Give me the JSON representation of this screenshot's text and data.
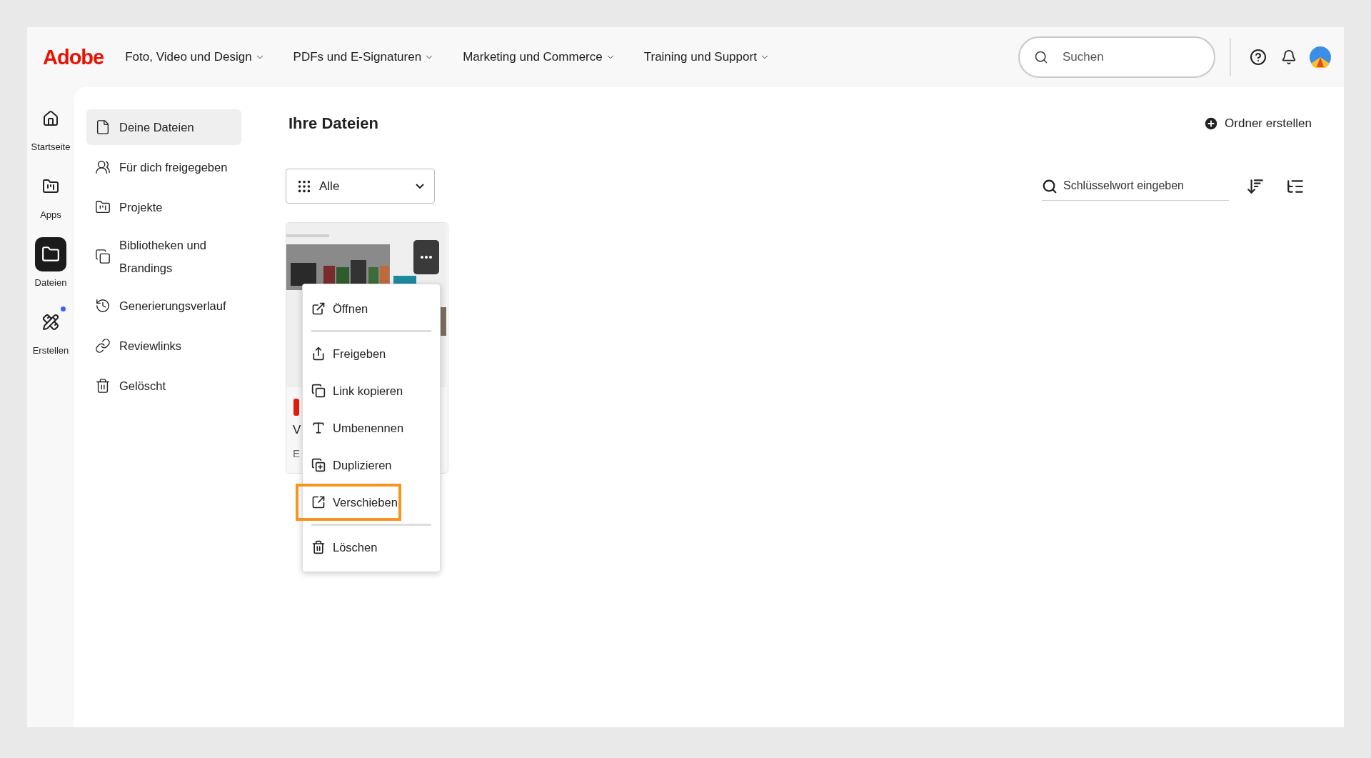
{
  "header": {
    "logo": "Adobe",
    "nav": [
      {
        "label": "Foto, Video und Design"
      },
      {
        "label": "PDFs und E-Signaturen"
      },
      {
        "label": "Marketing und Commerce"
      },
      {
        "label": "Training und Support"
      }
    ],
    "search": {
      "placeholder": "Suchen"
    }
  },
  "rail": [
    {
      "label": "Startseite",
      "selected": false,
      "notification": false
    },
    {
      "label": "Apps",
      "selected": false,
      "notification": false
    },
    {
      "label": "Dateien",
      "selected": true,
      "notification": false
    },
    {
      "label": "Erstellen",
      "selected": false,
      "notification": true
    }
  ],
  "sidebar": [
    {
      "label": "Deine Dateien",
      "selected": true
    },
    {
      "label": "Für dich freigegeben",
      "selected": false
    },
    {
      "label": "Projekte",
      "selected": false
    },
    {
      "label": "Bibliotheken und Brandings",
      "selected": false
    },
    {
      "label": "Generierungsverlauf",
      "selected": false
    },
    {
      "label": "Reviewlinks",
      "selected": false
    },
    {
      "label": "Gelöscht",
      "selected": false
    }
  ],
  "main": {
    "title": "Ihre Dateien",
    "create_folder": "Ordner erstellen",
    "filter": {
      "value": "Alle"
    },
    "keyword_search": {
      "placeholder": "Schlüsselwort eingeben"
    },
    "card": {
      "title": "V",
      "subtitle": "E"
    },
    "context_menu": [
      {
        "label": "Öffnen",
        "highlighted": false,
        "divider_after": true
      },
      {
        "label": "Freigeben",
        "highlighted": false,
        "divider_after": false
      },
      {
        "label": "Link kopieren",
        "highlighted": false,
        "divider_after": false
      },
      {
        "label": "Umbenennen",
        "highlighted": false,
        "divider_after": false
      },
      {
        "label": "Duplizieren",
        "highlighted": false,
        "divider_after": false
      },
      {
        "label": "Verschieben",
        "highlighted": true,
        "divider_after": true
      },
      {
        "label": "Löschen",
        "highlighted": false,
        "divider_after": false
      }
    ]
  }
}
